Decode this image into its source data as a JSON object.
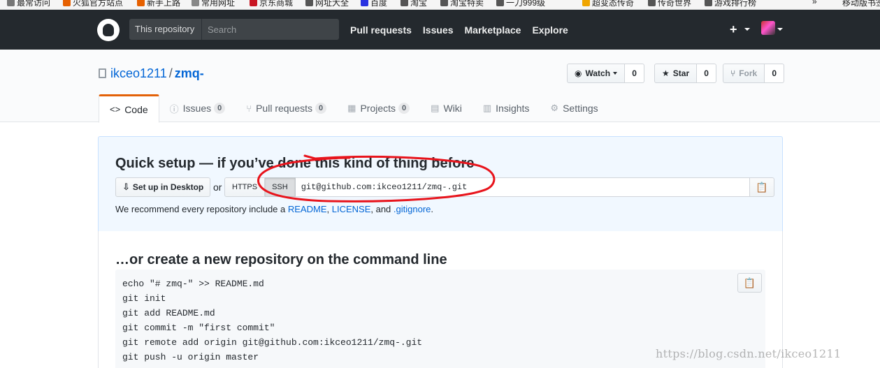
{
  "browser": {
    "bookmarks": [
      {
        "label": "最常访问",
        "color": "#777"
      },
      {
        "label": "火狐官方站点",
        "color": "#e66000"
      },
      {
        "label": "新手上路",
        "color": "#e66000"
      },
      {
        "label": "常用网址",
        "color": "#888"
      },
      {
        "label": "京东商城",
        "color": "#c81623"
      },
      {
        "label": "网址大全",
        "color": "#555"
      },
      {
        "label": "百度",
        "color": "#2932e1"
      },
      {
        "label": "淘宝",
        "color": "#555"
      },
      {
        "label": "淘宝特卖",
        "color": "#555"
      },
      {
        "label": "一刀999级",
        "color": "#555"
      },
      {
        "label": "超变态传奇",
        "color": "#f0a500"
      },
      {
        "label": "传奇世界",
        "color": "#555"
      },
      {
        "label": "游戏排行榜",
        "color": "#555"
      }
    ],
    "overflow": "»",
    "mobile": "移动版书签"
  },
  "header": {
    "search_scope": "This repository",
    "search_placeholder": "Search",
    "nav": [
      "Pull requests",
      "Issues",
      "Marketplace",
      "Explore"
    ],
    "plus": "+"
  },
  "repo": {
    "owner": "ikceo1211",
    "slash": "/",
    "name": "zmq-",
    "watch_label": "Watch",
    "watch_count": "0",
    "star_label": "Star",
    "star_count": "0",
    "fork_label": "Fork",
    "fork_count": "0"
  },
  "tabs": [
    {
      "label": "Code",
      "icon": "<>",
      "count": null
    },
    {
      "label": "Issues",
      "icon": "ⓘ",
      "count": "0"
    },
    {
      "label": "Pull requests",
      "icon": "⑂",
      "count": "0"
    },
    {
      "label": "Projects",
      "icon": "▦",
      "count": "0"
    },
    {
      "label": "Wiki",
      "icon": "▤",
      "count": null
    },
    {
      "label": "Insights",
      "icon": "▥",
      "count": null
    },
    {
      "label": "Settings",
      "icon": "⚙",
      "count": null
    }
  ],
  "quick_setup": {
    "title": "Quick setup — if you’ve done this kind of thing before",
    "desktop_label": "Set up in Desktop",
    "or": "or",
    "https_label": "HTTPS",
    "ssh_label": "SSH",
    "clone_url": "git@github.com:ikceo1211/zmq-.git",
    "recommend_prefix": "We recommend every repository include a ",
    "readme": "README",
    "comma1": ", ",
    "license": "LICENSE",
    "and": ", and ",
    "gitignore": ".gitignore",
    "period": "."
  },
  "command_line": {
    "title": "…or create a new repository on the command line",
    "lines": [
      "echo \"# zmq-\" >> README.md",
      "git init",
      "git add README.md",
      "git commit -m \"first commit\"",
      "git remote add origin git@github.com:ikceo1211/zmq-.git",
      "git push -u origin master"
    ]
  },
  "watermark": "https://blog.csdn.net/ikceo1211",
  "colors": {
    "header_bg": "#24292e",
    "link": "#0366d6",
    "tab_accent": "#e36209",
    "annotation": "#e8141c"
  }
}
